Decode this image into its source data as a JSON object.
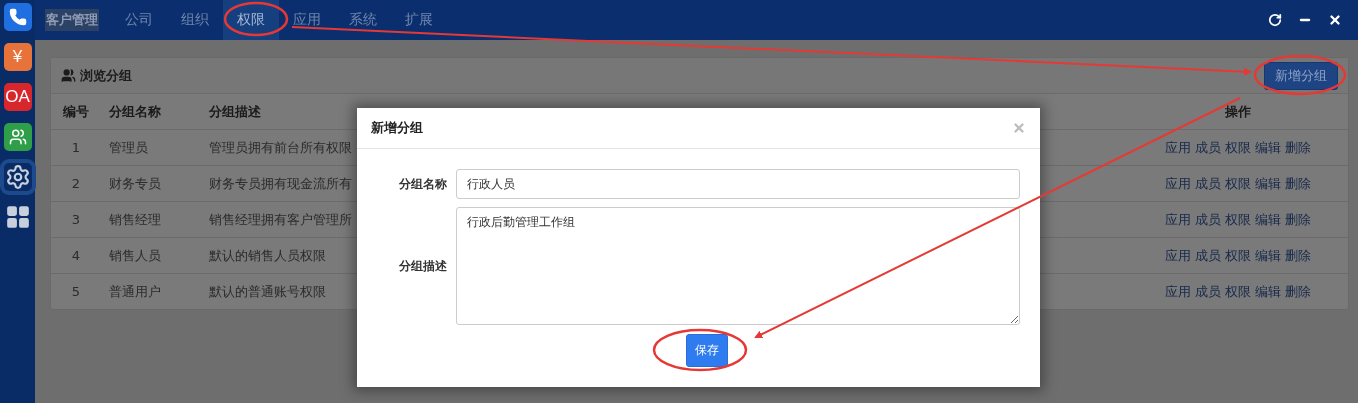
{
  "side_dock": {
    "items": [
      {
        "kind": "phone",
        "selected": false
      },
      {
        "kind": "text",
        "label": "¥",
        "color": "#e8733a",
        "selected": false
      },
      {
        "kind": "text",
        "label": "OA",
        "color": "#d7262c",
        "selected": false
      },
      {
        "kind": "people",
        "selected": false
      },
      {
        "kind": "gear",
        "selected": true
      },
      {
        "kind": "grid",
        "selected": false
      }
    ]
  },
  "top_bar": {
    "app_title": "客户管理",
    "tabs": [
      {
        "label": "公司",
        "selected": false
      },
      {
        "label": "组织",
        "selected": false
      },
      {
        "label": "权限",
        "selected": true
      },
      {
        "label": "应用",
        "selected": false
      },
      {
        "label": "系统",
        "selected": false
      },
      {
        "label": "扩展",
        "selected": false
      }
    ],
    "window_controls": [
      {
        "kind": "refresh"
      },
      {
        "kind": "minimize"
      },
      {
        "kind": "close"
      }
    ]
  },
  "panel": {
    "title": "浏览分组",
    "add_button": "新增分组",
    "table": {
      "columns": [
        "编号",
        "分组名称",
        "分组描述",
        "操作"
      ],
      "rows": [
        {
          "number": "1",
          "name": "管理员",
          "description": "管理员拥有前台所有权限",
          "actions": [
            "应用",
            "成员",
            "权限",
            "编辑",
            "删除"
          ]
        },
        {
          "number": "2",
          "name": "财务专员",
          "description": "财务专员拥有现金流所有",
          "actions": [
            "应用",
            "成员",
            "权限",
            "编辑",
            "删除"
          ]
        },
        {
          "number": "3",
          "name": "销售经理",
          "description": "销售经理拥有客户管理所",
          "actions": [
            "应用",
            "成员",
            "权限",
            "编辑",
            "删除"
          ]
        },
        {
          "number": "4",
          "name": "销售人员",
          "description": "默认的销售人员权限",
          "actions": [
            "应用",
            "成员",
            "权限",
            "编辑",
            "删除"
          ]
        },
        {
          "number": "5",
          "name": "普通用户",
          "description": "默认的普通账号权限",
          "actions": [
            "应用",
            "成员",
            "权限",
            "编辑",
            "删除"
          ]
        }
      ]
    }
  },
  "modal": {
    "title": "新增分组",
    "fields": [
      {
        "kind": "input",
        "label": "分组名称",
        "value": "行政人员"
      },
      {
        "kind": "textarea",
        "label": "分组描述",
        "value": "行政后勤管理工作组"
      }
    ],
    "save_button": "保存"
  }
}
